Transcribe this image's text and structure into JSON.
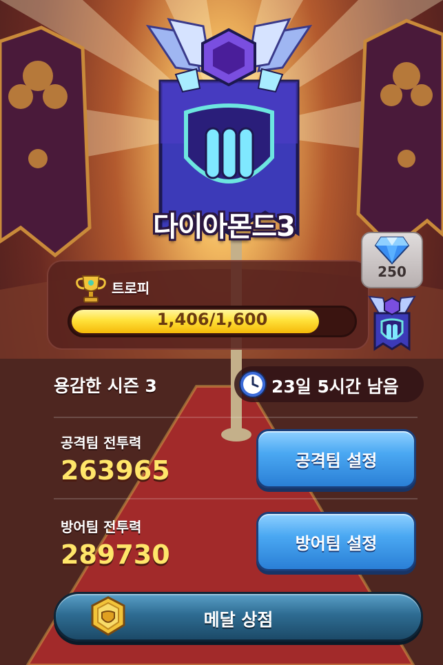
{
  "rank": {
    "label": "다이아몬드3",
    "tier_numeral_icon": "tier-III-shield-icon"
  },
  "trophy": {
    "label": "트로피",
    "progress_text": "1,406/1,600",
    "current": 1406,
    "target": 1600,
    "progress_fraction": 0.879
  },
  "reward": {
    "gem_count": "250",
    "next_rank_icon": "tier-II-emblem-icon"
  },
  "season": {
    "name": "용감한 시즌 3",
    "time_remaining": "23일 5시간 남음"
  },
  "attack": {
    "label": "공격팀 전투력",
    "value": "263965",
    "button_label": "공격팀 설정"
  },
  "defense": {
    "label": "방어팀 전투력",
    "value": "289730",
    "button_label": "방어팀 설정"
  },
  "shop": {
    "button_label": "메달 상점"
  },
  "colors": {
    "power_value": "#ffe66a",
    "progress_fill": "#ffe23a",
    "button_blue": "#4aa8f2",
    "shop_button": "#2e6c92"
  }
}
